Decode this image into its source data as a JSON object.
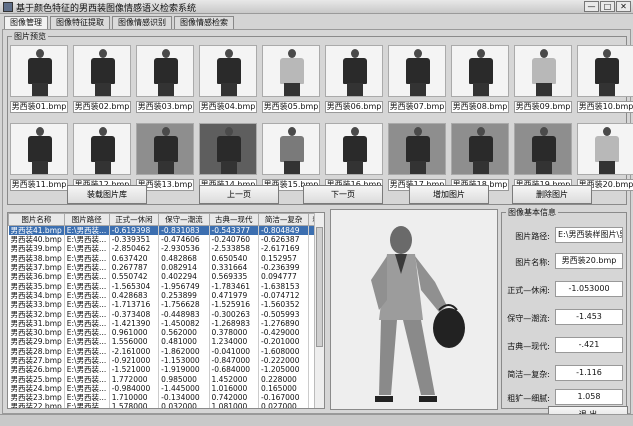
{
  "window": {
    "title": "基于颜色特征的男西装图像情感语义检索系统",
    "btn_min": "—",
    "btn_max": "□",
    "btn_close": "✕"
  },
  "tabs": [
    {
      "label": "图像管理"
    },
    {
      "label": "图像特征提取"
    },
    {
      "label": "图像情感识别"
    },
    {
      "label": "图像情感检索"
    }
  ],
  "thumbnails_group": {
    "label": "图片预览",
    "items": [
      {
        "caption": "男西装01.bmp",
        "style": "light"
      },
      {
        "caption": "男西装02.bmp",
        "style": "light"
      },
      {
        "caption": "男西装03.bmp",
        "style": "light"
      },
      {
        "caption": "男西装04.bmp",
        "style": "light"
      },
      {
        "caption": "男西装05.bmp",
        "style": "light"
      },
      {
        "caption": "男西装06.bmp",
        "style": "light"
      },
      {
        "caption": "男西装07.bmp",
        "style": "light"
      },
      {
        "caption": "男西装08.bmp",
        "style": "light"
      },
      {
        "caption": "男西装09.bmp",
        "style": "light"
      },
      {
        "caption": "男西装10.bmp",
        "style": "light"
      },
      {
        "caption": "男西装11.bmp",
        "style": "light"
      },
      {
        "caption": "男西装12.bmp",
        "style": "light"
      },
      {
        "caption": "男西装13.bmp",
        "style": "mid"
      },
      {
        "caption": "男西装14.bmp",
        "style": "dark"
      },
      {
        "caption": "男西装15.bmp",
        "style": "light"
      },
      {
        "caption": "男西装16.bmp",
        "style": "light"
      },
      {
        "caption": "男西装17.bmp",
        "style": "mid"
      },
      {
        "caption": "男西装18.bmp",
        "style": "mid"
      },
      {
        "caption": "男西装19.bmp",
        "style": "mid"
      },
      {
        "caption": "男西装20.bmp",
        "style": "light"
      }
    ]
  },
  "buttons": {
    "load": "装载图片库",
    "prev": "上一页",
    "next": "下一页",
    "add": "增加图片",
    "delete": "删除图片",
    "exit": "退  出"
  },
  "table": {
    "headers": [
      "图片名称",
      "图片路径",
      "正式—休闲",
      "保守—潮流",
      "古典—现代",
      "简洁—复杂",
      "粗"
    ],
    "selected_row": 0,
    "rows": [
      [
        "男西装41.bmp",
        "E:\\男西装...",
        "-0.619398",
        "-0.831083",
        "-0.543377",
        "-0.804849",
        ""
      ],
      [
        "男西装40.bmp",
        "E:\\男西装...",
        "-0.339351",
        "-0.474606",
        "-0.240760",
        "-0.626387",
        ""
      ],
      [
        "男西装39.bmp",
        "E:\\男西装...",
        "-2.850462",
        "-2.930536",
        "-2.533858",
        "-2.617169",
        ""
      ],
      [
        "男西装38.bmp",
        "E:\\男西装...",
        "0.637420",
        "0.482868",
        "0.650540",
        "0.152957",
        ""
      ],
      [
        "男西装37.bmp",
        "E:\\男西装...",
        "0.267787",
        "0.082914",
        "0.331664",
        "-0.236399",
        ""
      ],
      [
        "男西装36.bmp",
        "E:\\男西装...",
        "0.550742",
        "0.402294",
        "0.569335",
        "0.094777",
        ""
      ],
      [
        "男西装35.bmp",
        "E:\\男西装...",
        "-1.565304",
        "-1.956749",
        "-1.783461",
        "-1.638153",
        ""
      ],
      [
        "男西装34.bmp",
        "E:\\男西装...",
        "0.428683",
        "0.253899",
        "0.471979",
        "-0.074712",
        ""
      ],
      [
        "男西装33.bmp",
        "E:\\男西装...",
        "-1.713716",
        "-1.756628",
        "-1.525916",
        "-1.560352",
        ""
      ],
      [
        "男西装32.bmp",
        "E:\\男西装...",
        "-0.373408",
        "-0.448983",
        "-0.300263",
        "-0.505993",
        ""
      ],
      [
        "男西装31.bmp",
        "E:\\男西装...",
        "-1.421390",
        "-1.450082",
        "-1.268983",
        "-1.276890",
        ""
      ],
      [
        "男西装30.bmp",
        "E:\\男西装...",
        "0.961000",
        "0.562000",
        "0.378000",
        "-0.429000",
        ""
      ],
      [
        "男西装29.bmp",
        "E:\\男西装...",
        "1.556000",
        "0.481000",
        "1.234000",
        "-0.201000",
        ""
      ],
      [
        "男西装28.bmp",
        "E:\\男西装...",
        "-2.161000",
        "-1.862000",
        "-0.041000",
        "-1.608000",
        ""
      ],
      [
        "男西装27.bmp",
        "E:\\男西装...",
        "-0.921000",
        "-1.153000",
        "-0.847000",
        "-0.222000",
        ""
      ],
      [
        "男西装26.bmp",
        "E:\\男西装...",
        "-1.521000",
        "-1.919000",
        "-0.684000",
        "-1.205000",
        ""
      ],
      [
        "男西装25.bmp",
        "E:\\男西装...",
        "1.772000",
        "0.985000",
        "1.452000",
        "0.228000",
        ""
      ],
      [
        "男西装24.bmp",
        "E:\\男西装...",
        "-0.984000",
        "-1.445000",
        "1.016000",
        "0.165000",
        ""
      ],
      [
        "男西装23.bmp",
        "E:\\男西装...",
        "1.710000",
        "-0.134000",
        "0.742000",
        "-0.167000",
        ""
      ],
      [
        "男西装22.bmp",
        "E:\\男西装...",
        "1.578000",
        "0.032000",
        "1.081000",
        "0.027000",
        ""
      ]
    ]
  },
  "info": {
    "label": "图像基本信息",
    "path_label": "图片路径:",
    "path_value": "E:\\男西装样图片\\男",
    "name_label": "图片名称:",
    "name_value": "男西装20.bmp",
    "f1_label": "正式—休闲:",
    "f1_value": "-1.053000",
    "f2_label": "保守—潮流:",
    "f2_value": "-1.453",
    "f3_label": "古典—现代:",
    "f3_value": "-.421",
    "f4_label": "简洁—复杂:",
    "f4_value": "-1.116",
    "f5_label": "粗犷—细腻:",
    "f5_value": "1.058"
  }
}
